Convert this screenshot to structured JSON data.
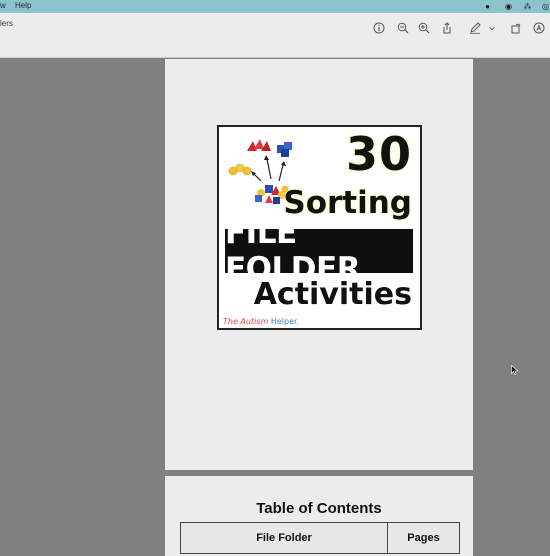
{
  "menubar": {
    "items": [
      "w",
      "Help"
    ]
  },
  "window": {
    "title": "lers"
  },
  "toolbar": {
    "icons": [
      "info-icon",
      "zoom-out-icon",
      "zoom-in-icon",
      "share-icon",
      "markup-pen-icon",
      "chevron-down-icon",
      "rotate-icon",
      "annotate-icon"
    ]
  },
  "cover": {
    "number": "30",
    "line1": "Sorting",
    "line2": "FILE FOLDER",
    "line3": "Activities",
    "logo_part1": "The Autism",
    "logo_part2": "Helper."
  },
  "page2": {
    "heading": "Table of Contents",
    "col1": "File Folder",
    "col2": "Pages"
  },
  "colors": {
    "menubar": "#8bc3cc",
    "highlight": "#f3f98a",
    "logo_red": "#e2474d",
    "logo_blue": "#3a7fb0"
  }
}
